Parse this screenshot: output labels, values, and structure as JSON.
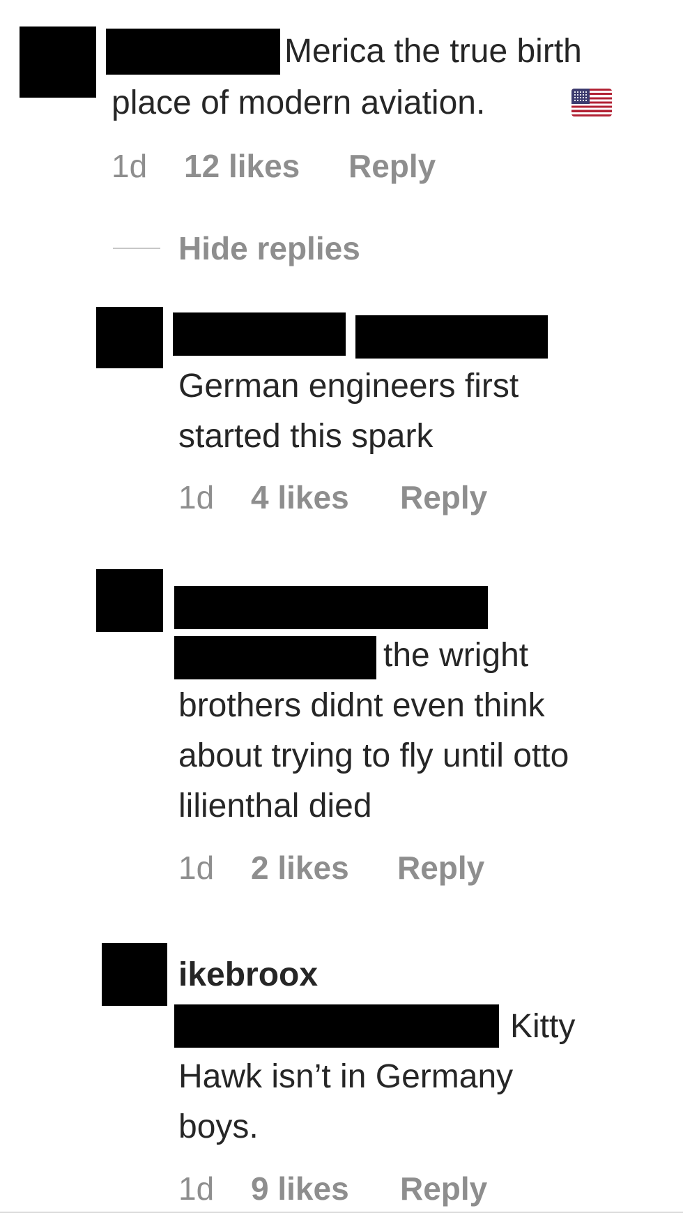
{
  "comment": {
    "text_line1": "Merica the true birth",
    "text_line2": "place of modern aviation.",
    "flag_icon": "us-flag-emoji",
    "time": "1d",
    "likes": "12 likes",
    "reply": "Reply",
    "hide_replies": "Hide replies"
  },
  "replies": [
    {
      "text_lines": [
        "German engineers first",
        "started this spark"
      ],
      "time": "1d",
      "likes": "4 likes",
      "reply": "Reply"
    },
    {
      "text_lines": [
        "the wright",
        "brothers didnt even think",
        "about trying to fly until otto",
        "lilienthal died"
      ],
      "time": "1d",
      "likes": "2 likes",
      "reply": "Reply"
    },
    {
      "username": "ikebroox",
      "text_lines": [
        "Kitty",
        "Hawk isn’t in Germany",
        "boys."
      ],
      "time": "1d",
      "likes": "9 likes",
      "reply": "Reply"
    }
  ],
  "colors": {
    "text": "#262626",
    "meta": "#8e8e8e",
    "redaction": "#000000"
  }
}
